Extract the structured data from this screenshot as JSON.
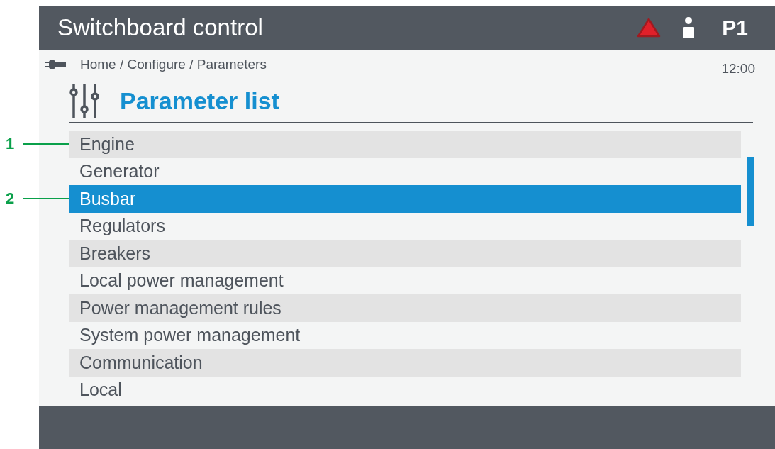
{
  "window": {
    "title": "Switchboard control",
    "alarm": true,
    "user": "P1"
  },
  "breadcrumb": "Home / Configure / Parameters",
  "time": "12:00",
  "heading": "Parameter list",
  "items": [
    {
      "label": "Engine",
      "selected": false,
      "callout": "1"
    },
    {
      "label": "Generator",
      "selected": false
    },
    {
      "label": "Busbar",
      "selected": true,
      "callout": "2"
    },
    {
      "label": "Regulators",
      "selected": false
    },
    {
      "label": "Breakers",
      "selected": false
    },
    {
      "label": "Local power management",
      "selected": false
    },
    {
      "label": "Power management rules",
      "selected": false
    },
    {
      "label": "System power management",
      "selected": false
    },
    {
      "label": "Communication",
      "selected": false
    },
    {
      "label": "Local",
      "selected": false
    }
  ]
}
